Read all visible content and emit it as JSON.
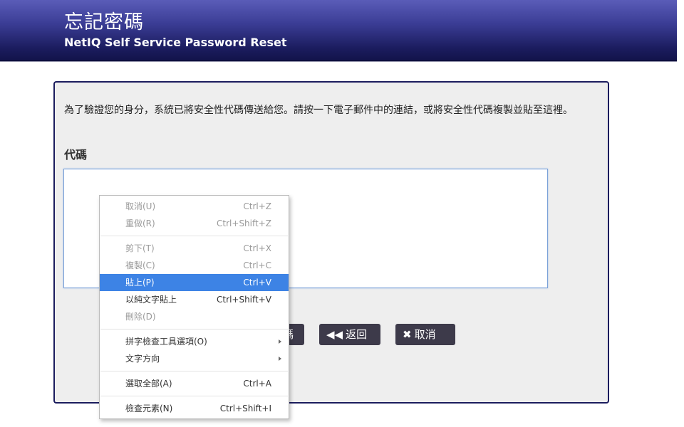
{
  "header": {
    "title": "忘記密碼",
    "subtitle": "NetIQ Self Service Password Reset"
  },
  "main": {
    "instructions": "為了驗證您的身分，系統已將安全性代碼傳送給您。請按一下電子郵件中的連結，或將安全性代碼複製並貼至這裡。",
    "code_label": "代碼",
    "code_value": ""
  },
  "buttons": {
    "next_label": "碼",
    "back_label": "返回",
    "cancel_label": "取消",
    "back_icon": "double-left-arrow-icon",
    "cancel_icon": "x-icon"
  },
  "context_menu": {
    "items": [
      {
        "label": "取消(U)",
        "shortcut": "Ctrl+Z"
      },
      {
        "label": "重做(R)",
        "shortcut": "Ctrl+Shift+Z"
      },
      {
        "label": "剪下(T)",
        "shortcut": "Ctrl+X"
      },
      {
        "label": "複製(C)",
        "shortcut": "Ctrl+C"
      },
      {
        "label": "貼上(P)",
        "shortcut": "Ctrl+V"
      },
      {
        "label": "以純文字貼上",
        "shortcut": "Ctrl+Shift+V"
      },
      {
        "label": "刪除(D)",
        "shortcut": ""
      },
      {
        "label": "拼字檢查工具選項(O)",
        "shortcut": ""
      },
      {
        "label": "文字方向",
        "shortcut": ""
      },
      {
        "label": "選取全部(A)",
        "shortcut": "Ctrl+A"
      },
      {
        "label": "檢查元素(N)",
        "shortcut": "Ctrl+Shift+I"
      }
    ]
  },
  "colors": {
    "header_dark": "#12134a",
    "header_light": "#5a5cb8",
    "panel_border": "#1b1c5e",
    "button_bg": "#3d3a4a",
    "menu_highlight": "#3d83e5"
  }
}
